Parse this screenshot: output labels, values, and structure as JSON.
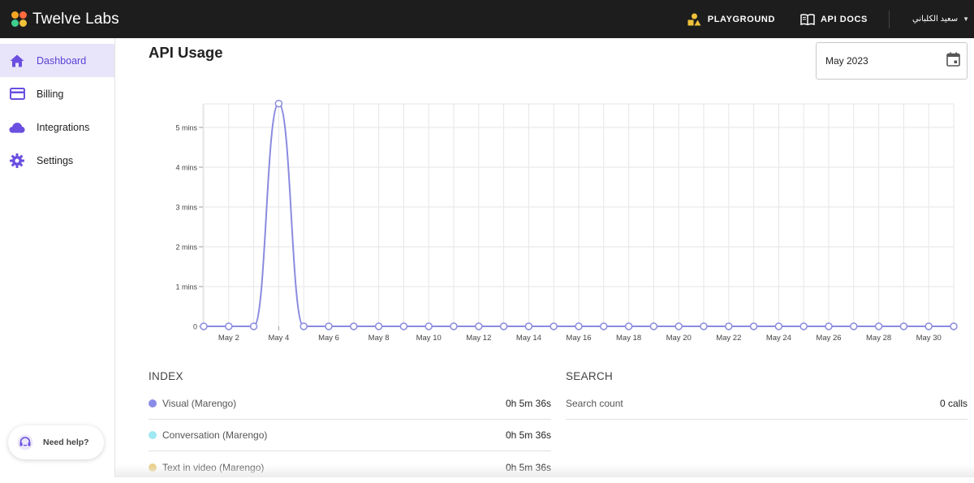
{
  "app": {
    "brand": "Twelve Labs",
    "nav": [
      {
        "label": "PLAYGROUND",
        "icon": "playground-shapes-icon"
      },
      {
        "label": "API DOCS",
        "icon": "book-icon"
      }
    ],
    "user_name": "سعيد الكلباني"
  },
  "sidebar": {
    "items": [
      {
        "label": "Dashboard",
        "icon": "home-icon",
        "active": true
      },
      {
        "label": "Billing",
        "icon": "credit-card-icon",
        "active": false
      },
      {
        "label": "Integrations",
        "icon": "cloud-icon",
        "active": false
      },
      {
        "label": "Settings",
        "icon": "gear-icon",
        "active": false
      }
    ],
    "help_label": "Need help?"
  },
  "main": {
    "title": "API Usage",
    "month": "May 2023"
  },
  "chart_data": {
    "type": "line",
    "title": "",
    "x": [
      "May 1",
      "May 2",
      "May 3",
      "May 4",
      "May 5",
      "May 6",
      "May 7",
      "May 8",
      "May 9",
      "May 10",
      "May 11",
      "May 12",
      "May 13",
      "May 14",
      "May 15",
      "May 16",
      "May 17",
      "May 18",
      "May 19",
      "May 20",
      "May 21",
      "May 22",
      "May 23",
      "May 24",
      "May 25",
      "May 26",
      "May 27",
      "May 28",
      "May 29",
      "May 30",
      "May 31"
    ],
    "x_tick_labels": [
      "May 2",
      "May 4",
      "May 6",
      "May 8",
      "May 10",
      "May 12",
      "May 14",
      "May 16",
      "May 18",
      "May 20",
      "May 22",
      "May 24",
      "May 26",
      "May 28",
      "May 30"
    ],
    "y_tick_labels": [
      "0",
      "1 mins",
      "2 mins",
      "3 mins",
      "4 mins",
      "5 mins"
    ],
    "series": [
      {
        "values": [
          0,
          0,
          0,
          5.6,
          0,
          0,
          0,
          0,
          0,
          0,
          0,
          0,
          0,
          0,
          0,
          0,
          0,
          0,
          0,
          0,
          0,
          0,
          0,
          0,
          0,
          0,
          0,
          0,
          0,
          0,
          0
        ]
      }
    ],
    "ylim": [
      0,
      5.6
    ],
    "grid": true,
    "color": "#8b8be0"
  },
  "index": {
    "title": "INDEX",
    "rows": [
      {
        "label": "Visual (Marengo)",
        "value": "0h 5m 36s",
        "color": "#8b8be8"
      },
      {
        "label": "Conversation (Marengo)",
        "value": "0h 5m 36s",
        "color": "#9fe8f2"
      },
      {
        "label": "Text in video (Marengo)",
        "value": "0h 5m 36s",
        "color": "#e8cf86"
      }
    ]
  },
  "search": {
    "title": "SEARCH",
    "rows": [
      {
        "label": "Search count",
        "value": "0 calls"
      }
    ]
  }
}
